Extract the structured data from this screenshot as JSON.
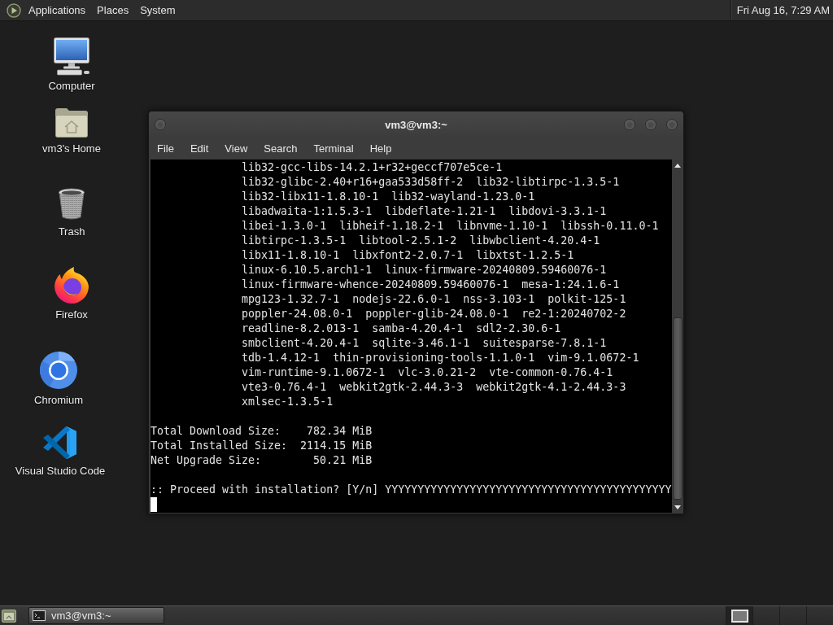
{
  "top_panel": {
    "menus": [
      "Applications",
      "Places",
      "System"
    ],
    "clock": "Fri Aug 16, 7:29 AM"
  },
  "desktop_icons": [
    {
      "kind": "computer",
      "label": "Computer"
    },
    {
      "kind": "home",
      "label": "vm3's Home"
    },
    {
      "kind": "trash",
      "label": "Trash"
    },
    {
      "kind": "firefox",
      "label": "Firefox"
    },
    {
      "kind": "chromium",
      "label": "Chromium"
    },
    {
      "kind": "vscode",
      "label": "Visual Studio Code"
    }
  ],
  "terminal": {
    "title": "vm3@vm3:~",
    "menu": [
      "File",
      "Edit",
      "View",
      "Search",
      "Terminal",
      "Help"
    ],
    "package_lines": [
      "lib32-gcc-libs-14.2.1+r32+geccf707e5ce-1",
      "lib32-glibc-2.40+r16+gaa533d58ff-2  lib32-libtirpc-1.3.5-1",
      "lib32-libx11-1.8.10-1  lib32-wayland-1.23.0-1",
      "libadwaita-1:1.5.3-1  libdeflate-1.21-1  libdovi-3.3.1-1",
      "libei-1.3.0-1  libheif-1.18.2-1  libnvme-1.10-1  libssh-0.11.0-1",
      "libtirpc-1.3.5-1  libtool-2.5.1-2  libwbclient-4.20.4-1",
      "libx11-1.8.10-1  libxfont2-2.0.7-1  libxtst-1.2.5-1",
      "linux-6.10.5.arch1-1  linux-firmware-20240809.59460076-1",
      "linux-firmware-whence-20240809.59460076-1  mesa-1:24.1.6-1",
      "mpg123-1.32.7-1  nodejs-22.6.0-1  nss-3.103-1  polkit-125-1",
      "poppler-24.08.0-1  poppler-glib-24.08.0-1  re2-1:20240702-2",
      "readline-8.2.013-1  samba-4.20.4-1  sdl2-2.30.6-1",
      "smbclient-4.20.4-1  sqlite-3.46.1-1  suitesparse-7.8.1-1",
      "tdb-1.4.12-1  thin-provisioning-tools-1.1.0-1  vim-9.1.0672-1",
      "vim-runtime-9.1.0672-1  vlc-3.0.21-2  vte-common-0.76.4-1",
      "vte3-0.76.4-1  webkit2gtk-2.44.3-3  webkit2gtk-4.1-2.44.3-3",
      "xmlsec-1.3.5-1"
    ],
    "summary": [
      {
        "label": "Total Download Size:",
        "value": "782.34 MiB"
      },
      {
        "label": "Total Installed Size:",
        "value": "2114.15 MiB"
      },
      {
        "label": "Net Upgrade Size:",
        "value": "50.21 MiB"
      }
    ],
    "prompt": ":: Proceed with installation? [Y/n]",
    "input": "YYYYYYYYYYYYYYYYYYYYYYYYYYYYYYYYYYYYYYYYYYYY",
    "cursor": true
  },
  "taskbar": {
    "tasks": [
      {
        "label": "vm3@vm3:~",
        "selected": true
      }
    ],
    "workspaces": [
      {
        "selected": true,
        "has_window": true
      },
      {
        "selected": false,
        "has_window": false
      },
      {
        "selected": false,
        "has_window": false
      },
      {
        "selected": false,
        "has_window": false
      }
    ]
  }
}
